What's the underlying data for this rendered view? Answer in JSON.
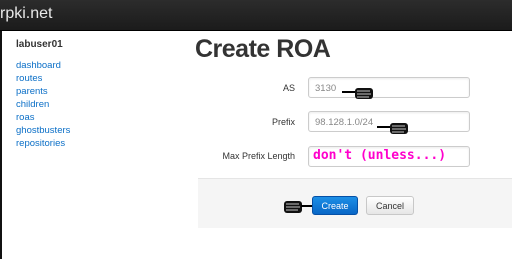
{
  "app": {
    "brand": "rpki.net"
  },
  "sidebar": {
    "user": "labuser01",
    "items": [
      {
        "label": "dashboard"
      },
      {
        "label": "routes"
      },
      {
        "label": "parents"
      },
      {
        "label": "children"
      },
      {
        "label": "roas"
      },
      {
        "label": "ghostbusters"
      },
      {
        "label": "repositories"
      }
    ]
  },
  "form": {
    "title": "Create ROA",
    "as": {
      "label": "AS",
      "value": "3130"
    },
    "prefix": {
      "label": "Prefix",
      "value": "98.128.1.0/24"
    },
    "max_prefix_length": {
      "label": "Max Prefix Length",
      "annotation": "don't (unless...)"
    },
    "create_label": "Create",
    "cancel_label": "Cancel"
  },
  "icons": {
    "pointer": "pointing-hand-icon"
  },
  "colors": {
    "link": "#0b6fc7",
    "primary": "#0866c6",
    "annotation": "#ff00cc",
    "topbar": "#1b1b1b"
  }
}
